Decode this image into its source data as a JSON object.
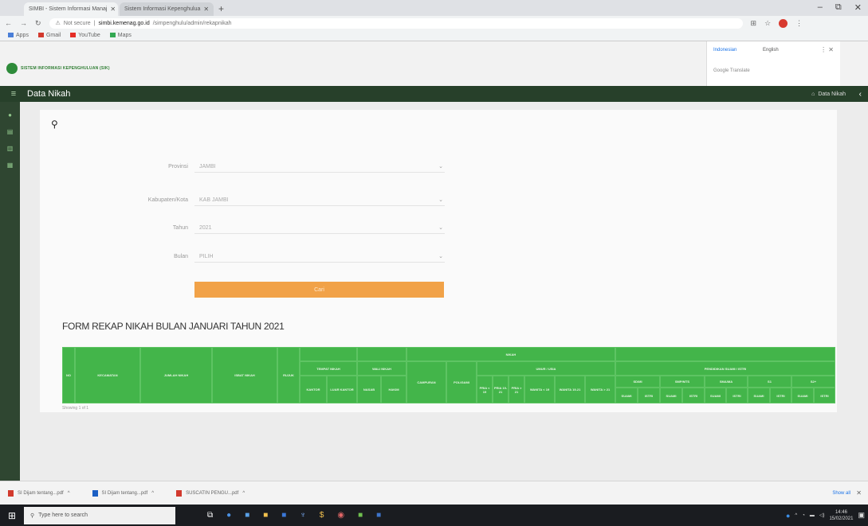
{
  "browser": {
    "tabs": [
      {
        "label": "SIMBI - Sistem Informasi Manaj",
        "active": true
      },
      {
        "label": "Sistem Informasi Kepenghulua",
        "active": false
      }
    ],
    "url_prefix": "Not secure",
    "url_domain": "simbi.kemenag.go.id",
    "url_path": "/simpenghulu/admin/rekapnikah",
    "bookmarks": [
      "Apps",
      "Gmail",
      "YouTube",
      "Maps"
    ],
    "window_controls": [
      "–",
      "⧉",
      "✕"
    ]
  },
  "translate": {
    "lang_active": "Indonesian",
    "lang_other": "English",
    "label": "Google Translate"
  },
  "site": {
    "logo_text": "SISTEM INFORMASI KEPENGHULUAN (SIK)",
    "page_title": "Data Nikah",
    "breadcrumb": "Data Nikah",
    "menu_icon": "hamburger-icon",
    "sidebar_icons": [
      "dashboard-icon",
      "list-icon",
      "chart-icon",
      "table-icon"
    ]
  },
  "form": {
    "fields": [
      {
        "label": "Provinsi",
        "value": "JAMBI"
      },
      {
        "label": "Kabupaten/Kota",
        "value": "KAB JAMBI"
      },
      {
        "label": "Tahun",
        "value": "2021"
      },
      {
        "label": "Bulan",
        "value": "PILIH"
      }
    ],
    "submit_label": "Cari"
  },
  "report": {
    "title": "FORM REKAP NIKAH BULAN JANUARI TAHUN 2021",
    "footer": "Showing 1 of 1",
    "headers": {
      "no": "NO",
      "kecamatan": "KECAMATAN",
      "jumlah_nikah": "JUMLAH NIKAH",
      "isbat_nikah": "ISBAT NIKAH",
      "rujuk": "RUJUK",
      "tempat_nikah": "TEMPAT NIKAH",
      "di_kantor": "KANTOR",
      "luar_kantor": "LUAR KANTOR",
      "wali_nikah": "WALI NIKAH",
      "nasab": "NASAB",
      "hakim": "HAKIM",
      "nikah": "NIKAH",
      "campuran": "CAMPURAN",
      "poligami": "POLIGAMI",
      "umur": "UMUR / USIA",
      "age_cols": [
        "PRIA < 19",
        "PRIA 19-21",
        "PRIA > 21",
        "WANITA < 19",
        "WANITA 19-21",
        "WANITA > 21"
      ],
      "pendidikan": "PENDIDIKAN SUAMI / ISTRI",
      "edu_groups": [
        "SD/MI",
        "SMP/MTS",
        "SMA/MA",
        "S1",
        "S2+"
      ],
      "suami": "SUAMI",
      "istri": "ISTRI"
    }
  },
  "downloads": {
    "items": [
      "SI Dijam tentang...pdf",
      "SI Dijam tentang...pdf",
      "SUSCATIN PENGU...pdf"
    ],
    "show_all": "Show all"
  },
  "taskbar": {
    "search_placeholder": "Type here to search",
    "time": "14:46",
    "date": "15/02/2021"
  }
}
